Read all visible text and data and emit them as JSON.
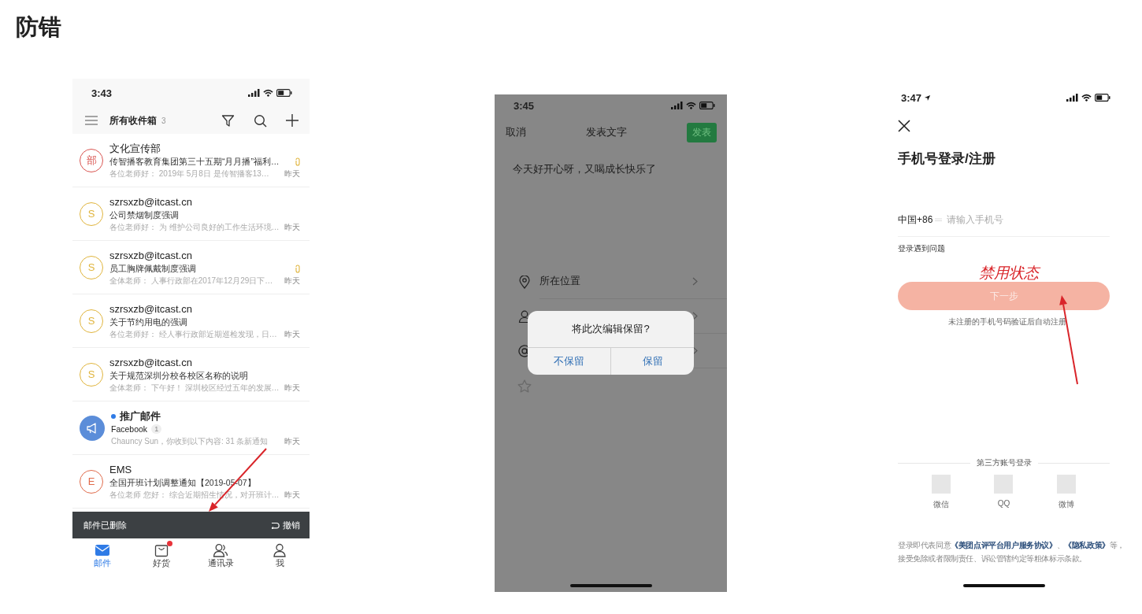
{
  "title": "防错",
  "screens": [
    {
      "kind": "mail_list",
      "status_time": "3:43",
      "header": {
        "title": "所有收件箱",
        "count": "3"
      },
      "mails": [
        {
          "avatar": "部",
          "kind": "letter",
          "color": "#d9534f",
          "sender": "文化宣传部",
          "unread": false,
          "subject": "传智播客教育集团第三十五期“月月播”福利…",
          "preview": "各位老师好： 2019年 5月8日 是传智播客13…",
          "time": "昨天",
          "attachment": true
        },
        {
          "avatar": "S",
          "kind": "letter",
          "color": "#e0b43c",
          "sender": "szrsxzb@itcast.cn",
          "unread": false,
          "subject": "公司禁烟制度强调",
          "preview": "各位老师好： 为 维护公司良好的工作生活环境…",
          "time": "昨天",
          "attachment": false
        },
        {
          "avatar": "S",
          "kind": "letter",
          "color": "#e0b43c",
          "sender": "szrsxzb@itcast.cn",
          "unread": false,
          "subject": "员工胸牌佩戴制度强调",
          "preview": "全体老师： 人事行政部在2017年12月29日下…",
          "time": "昨天",
          "attachment": true
        },
        {
          "avatar": "S",
          "kind": "letter",
          "color": "#e0b43c",
          "sender": "szrsxzb@itcast.cn",
          "unread": false,
          "subject": "关于节约用电的强调",
          "preview": "各位老师好： 经人事行政部近期巡检发现，日…",
          "time": "昨天",
          "attachment": false
        },
        {
          "avatar": "S",
          "kind": "letter",
          "color": "#e0b43c",
          "sender": "szrsxzb@itcast.cn",
          "unread": false,
          "subject": "关于规范深圳分校各校区名称的说明",
          "preview": "全体老师： 下午好！ 深圳校区经过五年的发展…",
          "time": "昨天",
          "attachment": false
        },
        {
          "kind": "megaphone",
          "color": "#5b8dd9",
          "sender": "推广邮件",
          "unread": true,
          "subject": "Facebook",
          "count": "1",
          "preview": "Chauncy Sun，你收到以下内容: 31 条新通知",
          "time": "昨天",
          "attachment": false
        },
        {
          "avatar": "E",
          "kind": "letter",
          "color": "#e06a4a",
          "sender": "EMS",
          "unread": false,
          "subject": "全国开班计划调整通知【2019-05-07】",
          "preview": "各位老师 您好： 综合近期招生情况，对开班计…",
          "time": "昨天",
          "attachment": false
        }
      ],
      "toast": {
        "text": "邮件已删除",
        "action": "撤销"
      },
      "tabs": [
        {
          "label": "邮件",
          "selected": true,
          "badge": false
        },
        {
          "label": "好货",
          "selected": false,
          "badge": true
        },
        {
          "label": "通讯录",
          "selected": false,
          "badge": false
        },
        {
          "label": "我",
          "selected": false,
          "badge": false
        }
      ],
      "annotations": [
        {
          "kind": "arrow"
        }
      ]
    },
    {
      "kind": "compose",
      "status_time": "3:45",
      "nav": {
        "cancel": "取消",
        "title": "发表文字",
        "submit": "发表"
      },
      "body_text": "今天好开心呀，又喝成长快乐了",
      "options": [
        {
          "kind": "location",
          "label": "所在位置",
          "chevron": true
        },
        {
          "kind": "person",
          "chevron": true
        },
        {
          "kind": "at",
          "chevron": true
        },
        {
          "kind": "star",
          "chevron": false
        }
      ],
      "dialog": {
        "title": "将此次编辑保留?",
        "buttons": [
          "不保留",
          "保留"
        ]
      }
    },
    {
      "kind": "login",
      "status_time": "3:47",
      "title": "手机号登录/注册",
      "phone_field": {
        "prefix": "中国+86",
        "placeholder": "请输入手机号"
      },
      "help_link": "登录遇到问题",
      "next_button": {
        "label": "下一步",
        "disabled": true
      },
      "note": "未注册的手机号码验证后自动注册",
      "third_party": {
        "title": "第三方账号登录",
        "options": [
          "微信",
          "QQ",
          "微博"
        ]
      },
      "legal_lines": [
        [
          {
            "text": "登录即代表同意",
            "link": false
          },
          {
            "text": "《美团点评平台用户服务协议》",
            "link": true
          },
          {
            "text": "、",
            "link": false
          },
          {
            "text": "《隐私政策》",
            "link": true
          },
          {
            "text": "等，",
            "link": false
          }
        ],
        [
          {
            "text": "接受免除或者限制责任、诉讼管辖约定等粗体标示条款。",
            "link": false
          }
        ]
      ],
      "annotations": [
        {
          "kind": "label",
          "text": "禁用状态"
        },
        {
          "kind": "arrow"
        }
      ]
    }
  ]
}
